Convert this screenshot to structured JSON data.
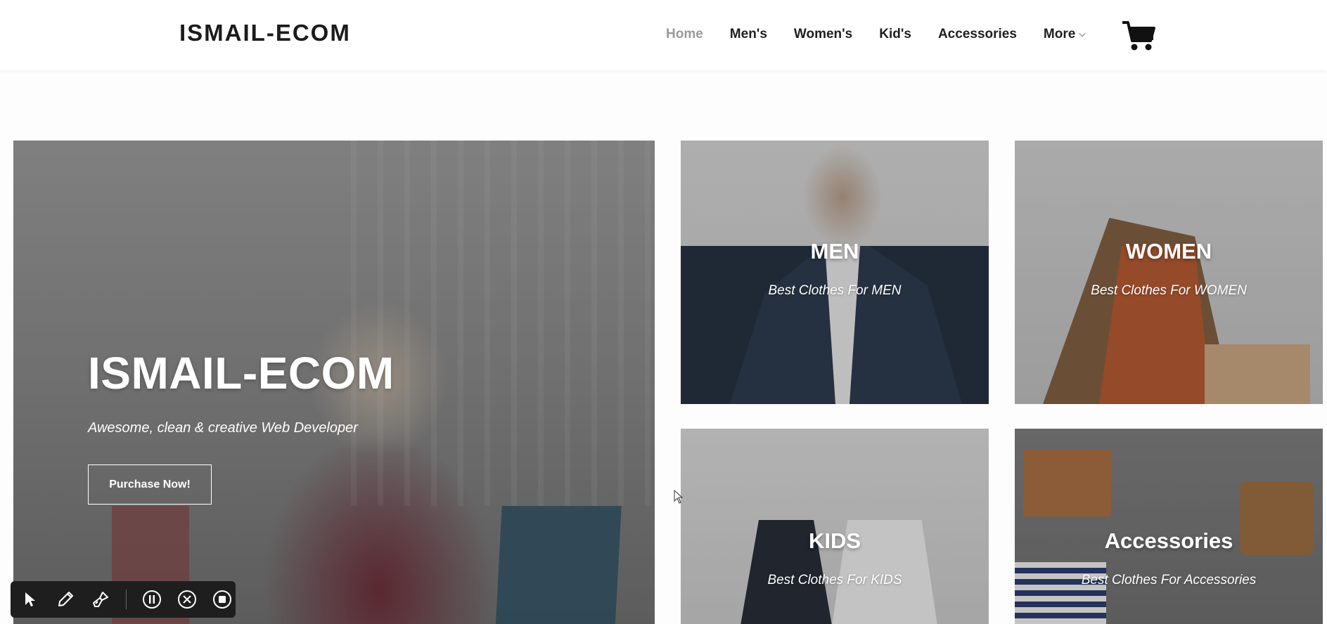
{
  "header": {
    "brand": "ISMAIL-ECOM",
    "nav": [
      {
        "label": "Home",
        "active": true
      },
      {
        "label": "Men's",
        "active": false
      },
      {
        "label": "Women's",
        "active": false
      },
      {
        "label": "Kid's",
        "active": false
      },
      {
        "label": "Accessories",
        "active": false
      },
      {
        "label": "More",
        "active": false
      }
    ],
    "cart_icon": "shopping-cart-icon"
  },
  "hero": {
    "title": "ISMAIL-ECOM",
    "subtitle": "Awesome, clean & creative Web Developer",
    "button_label": "Purchase Now!"
  },
  "categories": [
    {
      "title": "MEN",
      "subtitle": "Best Clothes For MEN"
    },
    {
      "title": "WOMEN",
      "subtitle": "Best Clothes For WOMEN"
    },
    {
      "title": "KIDS",
      "subtitle": "Best Clothes For KIDS"
    },
    {
      "title": "Accessories",
      "subtitle": "Best Clothes For Accessories"
    }
  ],
  "toolbar": {
    "tools": [
      "pointer-icon",
      "pencil-icon",
      "brush-icon",
      "pause-icon",
      "close-icon",
      "stop-icon"
    ]
  },
  "colors": {
    "header_bg": "#ffffff",
    "nav_active": "#9a9a9a",
    "nav_text": "#1f1f1f",
    "toolbar_bg": "#1e1e1e"
  }
}
